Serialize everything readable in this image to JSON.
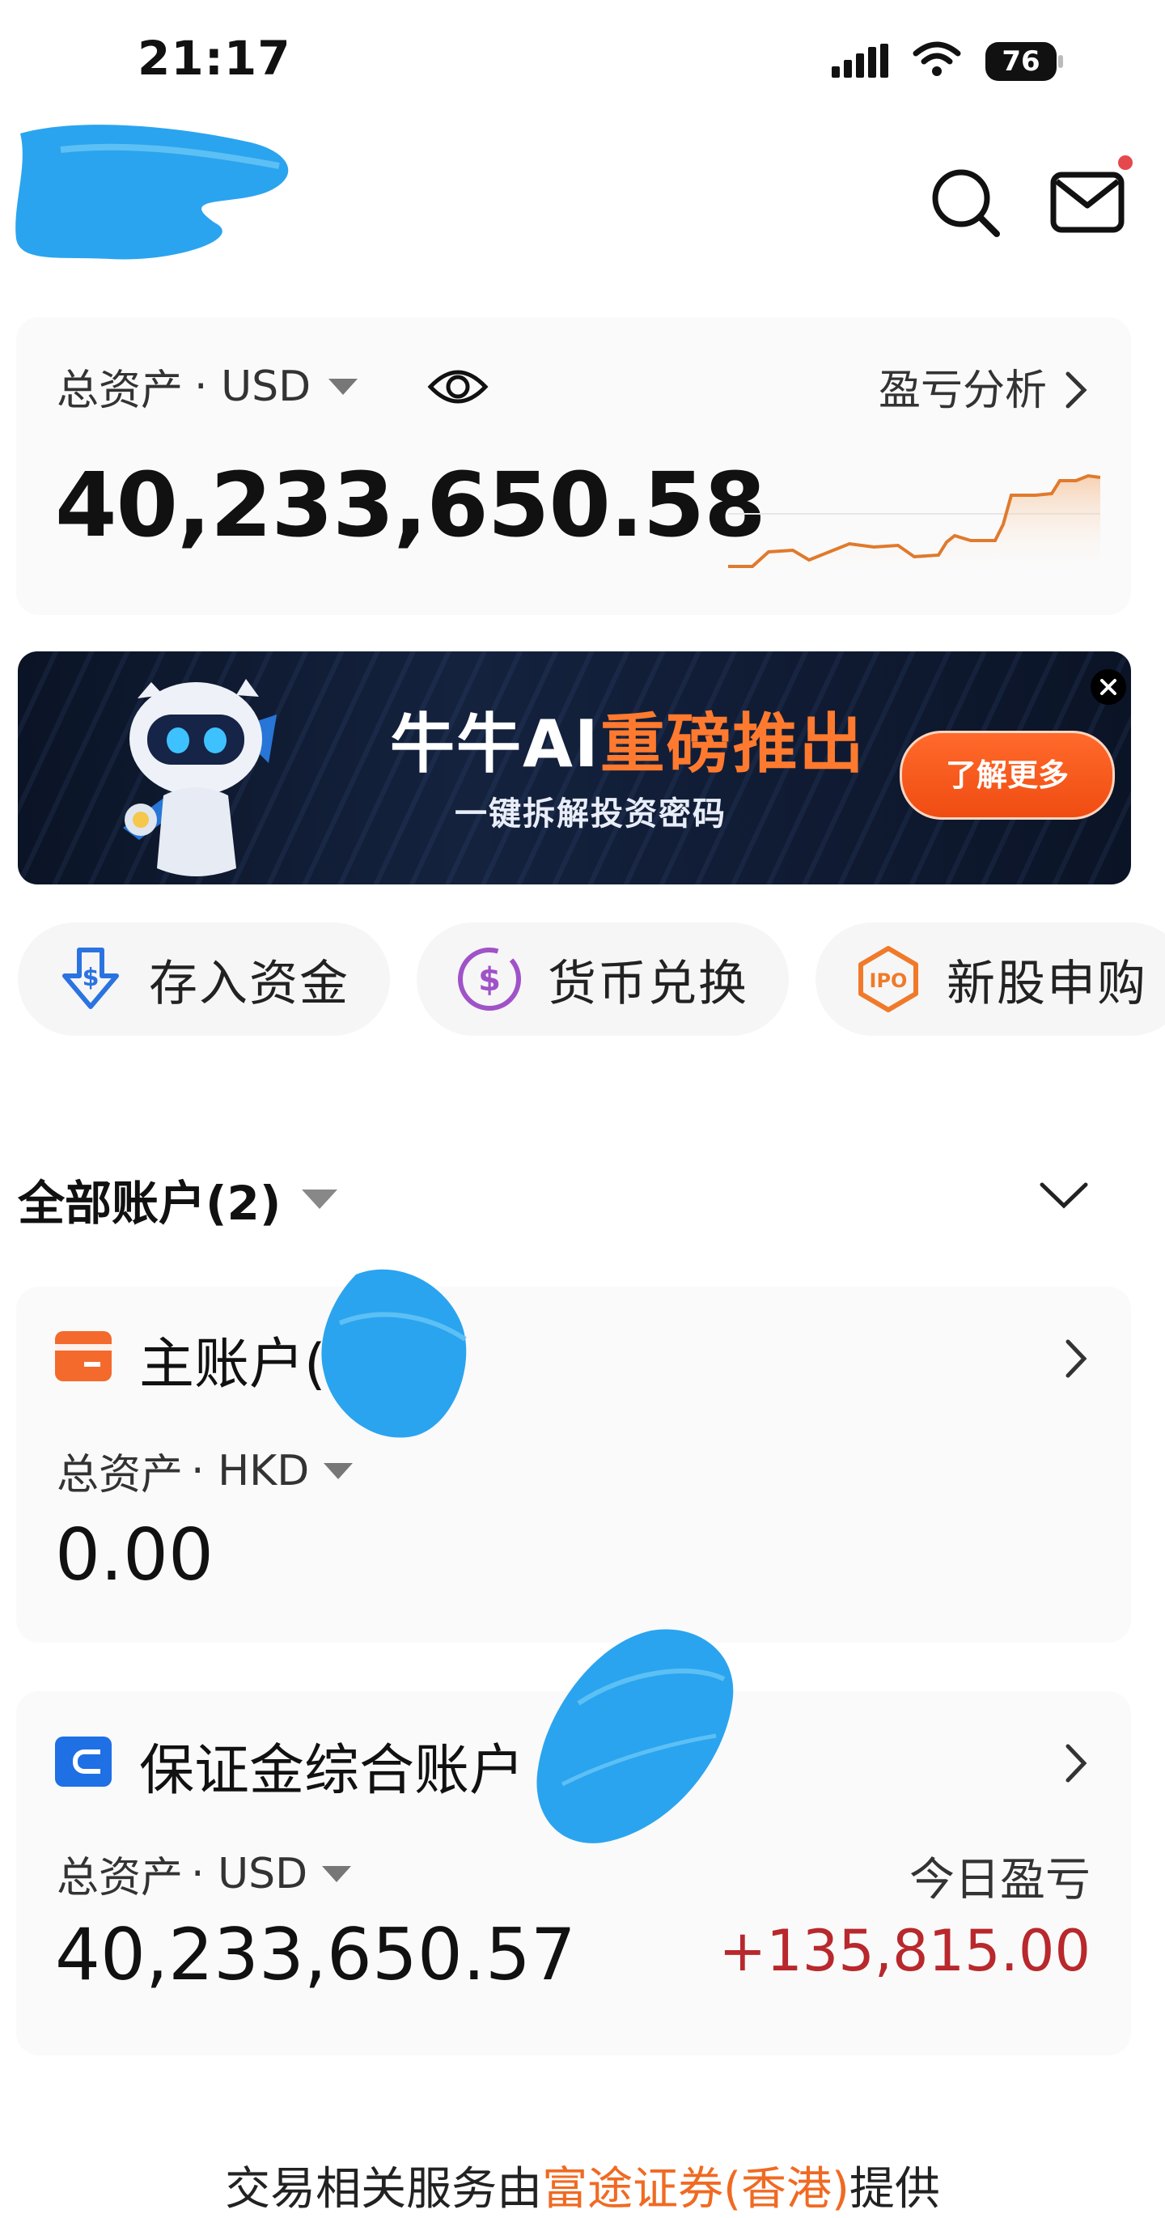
{
  "status_bar": {
    "time": "21:17",
    "battery": "76",
    "icons": [
      "cellular-signal-icon",
      "wifi-icon",
      "battery-icon"
    ]
  },
  "header": {
    "icons": [
      "search-icon",
      "mail-icon"
    ],
    "notification_dot_color": "#e5484d"
  },
  "total_assets": {
    "label": "总资产",
    "currency": "· USD",
    "value": "40,233,650.58",
    "pnl_link": "盈亏分析",
    "trend_color": "#e07a2c"
  },
  "banner": {
    "title_white": "牛牛AI",
    "title_orange": "重磅推出",
    "subtitle": "一键拆解投资密码",
    "cta": "了解更多"
  },
  "quick_actions": [
    {
      "label": "存入资金",
      "icon": "deposit-icon",
      "color": "#2b73e0"
    },
    {
      "label": "货币兑换",
      "icon": "currency-exchange-icon",
      "color": "#a052c8"
    },
    {
      "label": "新股申购",
      "icon": "ipo-icon",
      "color": "#f07a2a"
    }
  ],
  "accounts_section": {
    "title": "全部账户(2)"
  },
  "accounts": [
    {
      "name": "主账户(",
      "icon": "card-icon",
      "color": "#f46a2c",
      "asset_label": "总资产",
      "currency": "· HKD",
      "value": "0.00"
    },
    {
      "name": "保证金综合账户",
      "icon": "margin-account-icon",
      "color": "#1f6fe5",
      "asset_label": "总资产",
      "currency": "· USD",
      "value": "40,233,650.57",
      "today_label": "今日盈亏",
      "today_value": "+135,815.00"
    }
  ],
  "footer": {
    "text_before": "交易相关服务由",
    "link": "富途证券(香港)",
    "text_after": "提供"
  }
}
